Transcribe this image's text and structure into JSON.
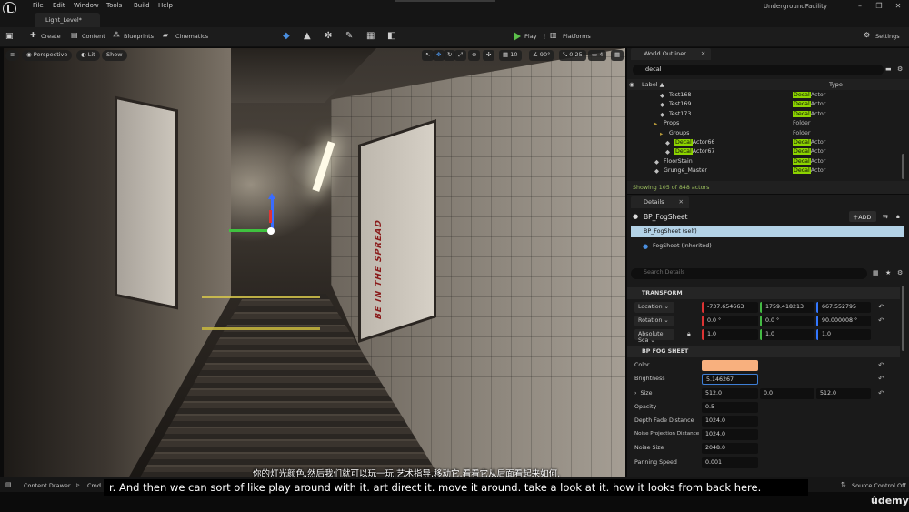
{
  "window": {
    "project_name": "UndergroundFacility",
    "level_tab": "Light_Level*",
    "menu": [
      "File",
      "Edit",
      "Window",
      "Tools",
      "Build",
      "Help"
    ]
  },
  "toolbar": {
    "create": "Create",
    "content": "Content",
    "blueprints": "Blueprints",
    "cinematics": "Cinematics",
    "play": "Play",
    "platforms": "Platforms",
    "settings": "Settings"
  },
  "viewport": {
    "perspective": "Perspective",
    "lit": "Lit",
    "show": "Show",
    "grid_value": "10",
    "angle_value": "90°",
    "scale_value": "0.25",
    "camera_speed": "4",
    "poster_text": "BE IN THE SPREAD"
  },
  "outliner": {
    "tab": "World Outliner",
    "search_value": "decal",
    "col_label": "Label ▲",
    "col_type": "Type",
    "rows": [
      {
        "indent": 46,
        "prefix": "Test168",
        "hl": "",
        "suffix": "",
        "type_hl": "Decal",
        "type_rest": "Actor",
        "type_plain": "",
        "icon": "actor"
      },
      {
        "indent": 46,
        "prefix": "Test169",
        "hl": "",
        "suffix": "",
        "type_hl": "Decal",
        "type_rest": "Actor",
        "type_plain": "",
        "icon": "actor"
      },
      {
        "indent": 46,
        "prefix": "Test173",
        "hl": "",
        "suffix": "",
        "type_hl": "Decal",
        "type_rest": "Actor",
        "type_plain": "",
        "icon": "actor"
      },
      {
        "indent": 40,
        "prefix": "Props",
        "hl": "",
        "suffix": "",
        "type_hl": "",
        "type_rest": "",
        "type_plain": "Folder",
        "icon": "folder"
      },
      {
        "indent": 46,
        "prefix": "Groups",
        "hl": "",
        "suffix": "",
        "type_hl": "",
        "type_rest": "",
        "type_plain": "Folder",
        "icon": "folder"
      },
      {
        "indent": 52,
        "prefix": "",
        "hl": "Decal",
        "suffix": "Actor66",
        "type_hl": "Decal",
        "type_rest": "Actor",
        "type_plain": "",
        "icon": "actor"
      },
      {
        "indent": 52,
        "prefix": "",
        "hl": "Decal",
        "suffix": "Actor67",
        "type_hl": "Decal",
        "type_rest": "Actor",
        "type_plain": "",
        "icon": "actor"
      },
      {
        "indent": 40,
        "prefix": "FloorStain",
        "hl": "",
        "suffix": "",
        "type_hl": "Decal",
        "type_rest": "Actor",
        "type_plain": "",
        "icon": "actor"
      },
      {
        "indent": 40,
        "prefix": "Grunge_Master",
        "hl": "",
        "suffix": "",
        "type_hl": "Decal",
        "type_rest": "Actor",
        "type_plain": "",
        "icon": "actor"
      }
    ],
    "footer": "Showing 105 of 848 actors"
  },
  "details": {
    "tab": "Details",
    "object_name": "BP_FogSheet",
    "add_label": "ADD",
    "component_self": "BP_FogSheet (self)",
    "component_inherited": "FogSheet (Inherited)",
    "search_placeholder": "Search Details",
    "transform_section": "TRANSFORM",
    "location_label": "Location",
    "location": [
      "-737.654663",
      "1759.418213",
      "667.552795"
    ],
    "rotation_label": "Rotation",
    "rotation": [
      "0.0 °",
      "0.0 °",
      "90.000008 °"
    ],
    "scale_label": "Absolute Sca",
    "scale": [
      "1.0",
      "1.0",
      "1.0"
    ],
    "fog_section": "BP FOG SHEET",
    "color_label": "Color",
    "color_value": "#f8b07e",
    "brightness_label": "Brightness",
    "brightness_value": "5.146267",
    "size_label": "Size",
    "size": [
      "512.0",
      "0.0",
      "512.0"
    ],
    "opacity_label": "Opacity",
    "opacity_value": "0.5",
    "depth_fade_label": "Depth Fade Distance",
    "depth_fade_value": "1024.0",
    "noise_proj_label": "Noise Projection Distance",
    "noise_proj_value": "1024.0",
    "noise_size_label": "Noise Size",
    "noise_size_value": "2048.0",
    "panning_label": "Panning Speed",
    "panning_value": "0.001"
  },
  "statusbar": {
    "content_drawer": "Content Drawer",
    "cmd": "Cmd",
    "source_control": "Source Control Off"
  },
  "subtitles": {
    "chinese": "你的灯光颜色,然后我们就可以玩一玩,艺术指导,移动它,看看它从后面看起来如何,",
    "english": "r. And then we can sort of like play around with it. art direct it. move it around. take a look at it. how it looks from back here."
  },
  "watermark": "ûdemy",
  "colors": {
    "accent_green": "#8dd400",
    "play_green": "#5cc04a",
    "selection_blue": "#b3d2e6"
  }
}
